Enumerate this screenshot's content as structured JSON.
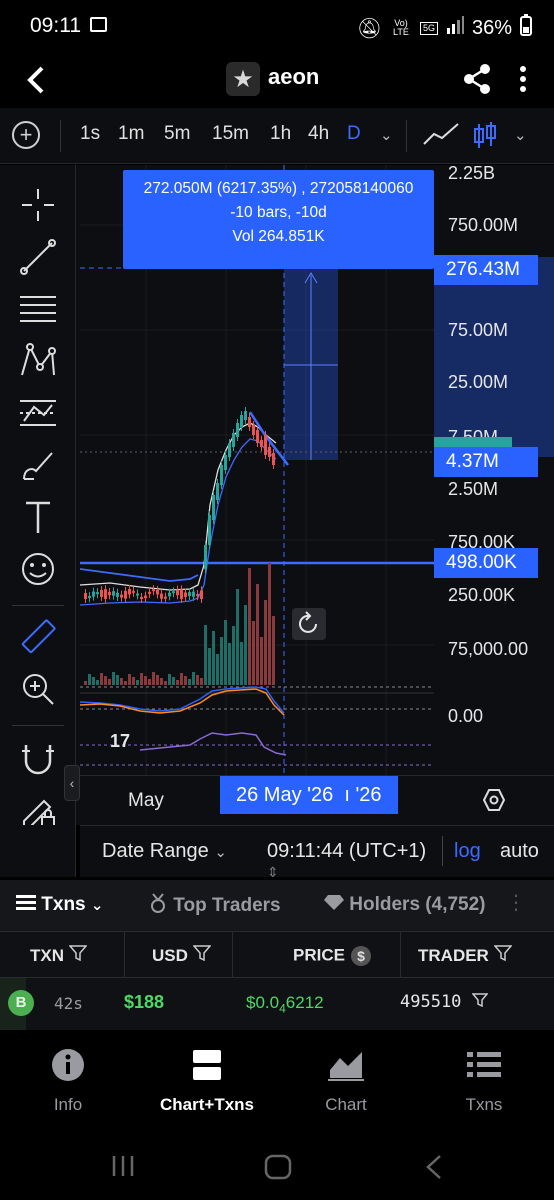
{
  "status_bar": {
    "time": "09:11",
    "network_badge": "Vo) LTE",
    "network_type": "5G",
    "battery": "36%"
  },
  "header": {
    "title": "aeon"
  },
  "toolbar": {
    "timeframes": [
      "1s",
      "1m",
      "5m",
      "15m",
      "1h",
      "4h",
      "D"
    ],
    "active_timeframe": "D"
  },
  "chart": {
    "scale": "log",
    "price_scale_labels": [
      "2.25B",
      "750.00M",
      "75.00M",
      "25.00M",
      "7.50M",
      "2.50M",
      "750.00K",
      "250.00K",
      "75,000.00",
      "0.00"
    ],
    "tags": {
      "target": "276.43M",
      "current": "4.37M",
      "level": "498.00K"
    },
    "tooltip": {
      "line1": "272.050M (6217.35%) , 272058140060",
      "line2": "-10 bars, -10d",
      "line3": "Vol 264.851K"
    },
    "rsi_label": "17",
    "time_axis": {
      "month": "May",
      "date_tag": "26 May '26",
      "date_tag_suffix": "ı '26"
    }
  },
  "range_bar": {
    "date_range": "Date Range",
    "clock": "09:11:44 (UTC+1)",
    "log": "log",
    "auto": "auto"
  },
  "tabs": [
    {
      "label": "Txns",
      "icon": "list-icon"
    },
    {
      "label": "Top Traders",
      "icon": "medal-icon"
    },
    {
      "label": "Holders (4,752)",
      "icon": "diamond-icon"
    }
  ],
  "table": {
    "headers": [
      "TXN",
      "USD",
      "PRICE",
      "TRADER"
    ],
    "rows": [
      {
        "type": "B",
        "age": "42s",
        "usd": "$188",
        "price_prefix": "$0.0",
        "price_sub": "4",
        "price_rest": "6212",
        "trader": "495510"
      }
    ]
  },
  "bottom_nav": [
    {
      "label": "Info",
      "icon": "info-icon"
    },
    {
      "label": "Chart+Txns",
      "icon": "chart-txns-icon"
    },
    {
      "label": "Chart",
      "icon": "area-chart-icon"
    },
    {
      "label": "Txns",
      "icon": "list-icon"
    }
  ],
  "colors": {
    "accent": "#2962ff",
    "buy": "#4caf50",
    "up": "#26a69a",
    "down": "#ef5350"
  }
}
